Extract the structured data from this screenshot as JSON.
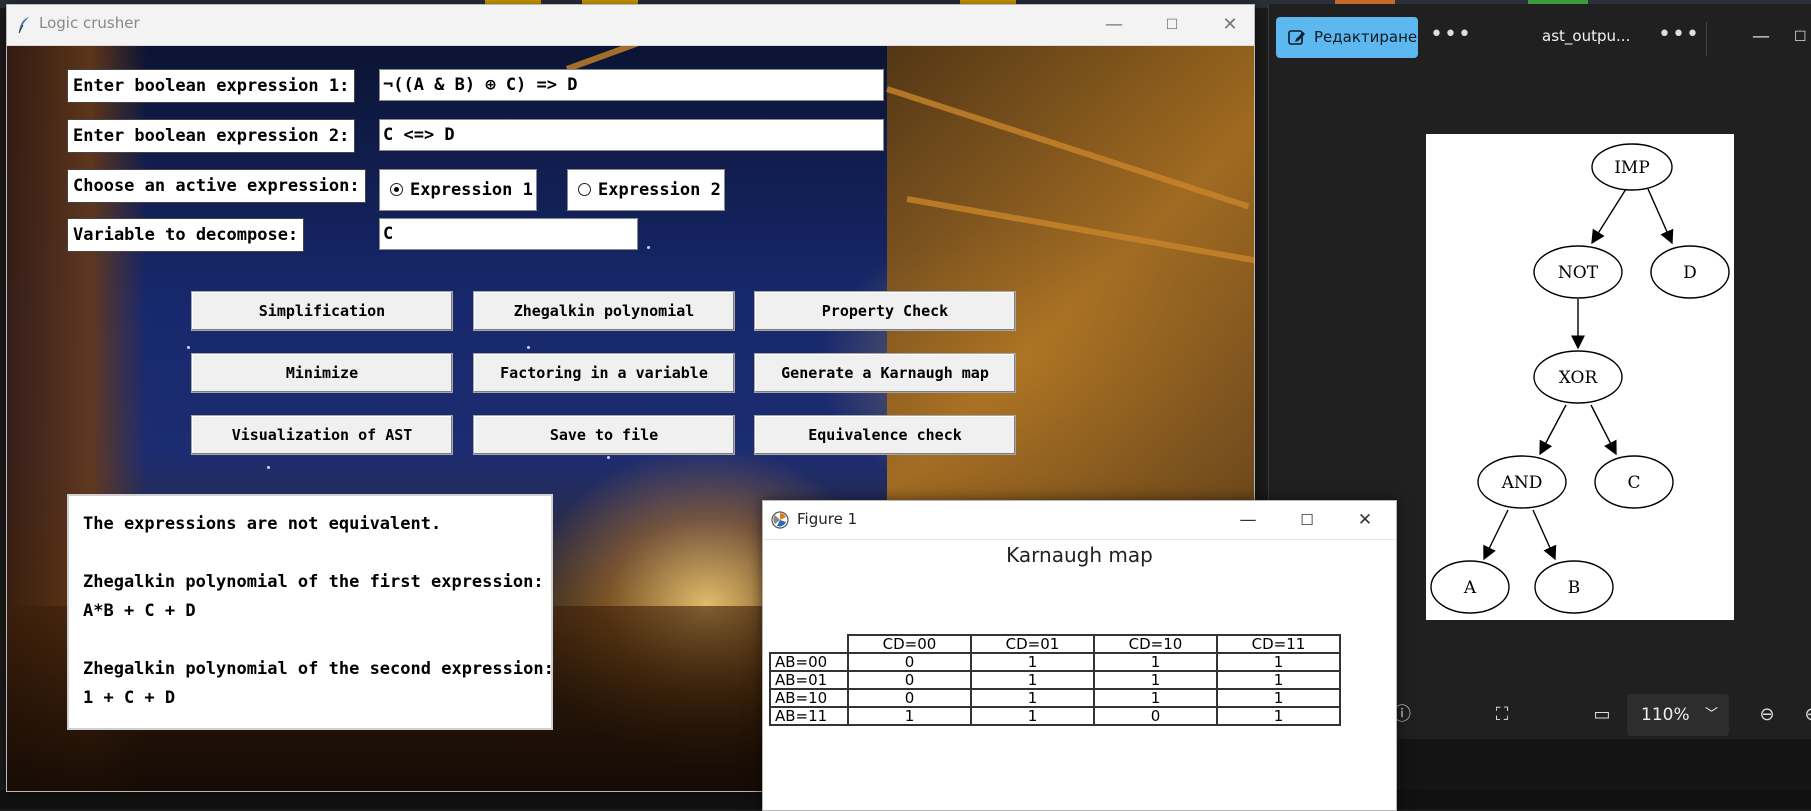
{
  "logic_window": {
    "title": "Logic crusher",
    "controls": {
      "minimize": "—",
      "maximize": "☐",
      "close": "✕"
    },
    "expr1_label": "Enter boolean expression 1:",
    "expr1_value": "¬((A & B) ⊕ C) => D",
    "expr2_label": "Enter boolean expression 2:",
    "expr2_value": "C <=> D",
    "active_label": "Choose an active expression:",
    "radio_options": [
      {
        "label": "Expression 1",
        "selected": true
      },
      {
        "label": "Expression 2",
        "selected": false
      }
    ],
    "decompose_label": "Variable to decompose:",
    "decompose_value": "C",
    "buttons": [
      "Simplification",
      "Zhegalkin polynomial",
      "Property Check",
      "Minimize",
      "Factoring in a variable",
      "Generate a Karnaugh  map",
      "Visualization of AST",
      "Save to file",
      "Equivalence check"
    ],
    "output_lines": [
      "The expressions are not equivalent.",
      "",
      "Zhegalkin polynomial of the first expression:",
      "A*B + C + D",
      "",
      "Zhegalkin polynomial of the second expression:",
      "1 + C + D"
    ]
  },
  "figure_window": {
    "title": "Figure 1",
    "controls": {
      "minimize": "—",
      "maximize": "☐",
      "close": "✕"
    },
    "plot_title": "Karnaugh map",
    "columns": [
      "CD=00",
      "CD=01",
      "CD=10",
      "CD=11"
    ],
    "rows": [
      {
        "label": "AB=00",
        "values": [
          "0",
          "1",
          "1",
          "1"
        ]
      },
      {
        "label": "AB=01",
        "values": [
          "0",
          "1",
          "1",
          "1"
        ]
      },
      {
        "label": "AB=10",
        "values": [
          "0",
          "1",
          "1",
          "1"
        ]
      },
      {
        "label": "AB=11",
        "values": [
          "1",
          "1",
          "0",
          "1"
        ]
      }
    ]
  },
  "viewer_window": {
    "edit_label": "Редактиране",
    "file_name": "ast_outpu...",
    "more_icon": "more-horizontal-icon",
    "zoom": "110%",
    "ast_nodes": [
      "IMP",
      "NOT",
      "D",
      "XOR",
      "AND",
      "C",
      "A",
      "B"
    ]
  },
  "colors": {
    "accent_edit": "#5cb8ef",
    "viewer_bg": "#202020"
  }
}
